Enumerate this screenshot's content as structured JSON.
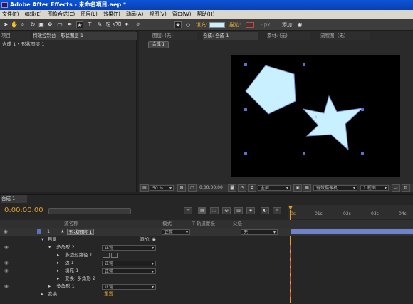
{
  "window": {
    "title": "Adobe After Effects - 未命名项目.aep *"
  },
  "menu": [
    "文件(F)",
    "编辑(E)",
    "图像合成(C)",
    "图层(L)",
    "效果(T)",
    "动画(A)",
    "视图(V)",
    "窗口(W)",
    "帮助(H)"
  ],
  "toolbar": {
    "fill_label": "填充:",
    "stroke_label": "描边:",
    "stroke_px": "- px",
    "add_label": "添加:",
    "fill_color": "#c8f0ff",
    "stroke_color": "#cc4444"
  },
  "project_panel": {
    "tab": "项目",
    "effects_tab": "特效控制台 : 形状图层 1",
    "breadcrumb": "合成 1 • 形状图层 1"
  },
  "comp_panel": {
    "tab_layer": "图层: (无)",
    "tab_comp": "合成: 合成 1",
    "tab_footage": "素材: (无)",
    "tab_flow": "流程图: (无)",
    "comp_button": "合成 1",
    "shape_color": "#c8f0ff"
  },
  "viewer_bar": {
    "zoom": "50 %",
    "time": "0:00:00:00",
    "resolution": "全屏",
    "camera": "有效摄像机",
    "views": "1 视图"
  },
  "timeline": {
    "tab": "合成 1",
    "time": "0:00:00:00",
    "ruler": [
      "0s",
      "01s",
      "02s",
      "03s",
      "04s"
    ],
    "headers": {
      "source": "源名称",
      "mode": "模式",
      "trkmat": "T 轨道蒙板",
      "parent": "父级"
    },
    "layer": {
      "num": "1",
      "name": "形状图层 1",
      "mode": "正常",
      "parent": "无"
    },
    "rows": [
      {
        "label": "目录",
        "extra": "添加:"
      },
      {
        "label": "多角形 2",
        "value": "正常"
      },
      {
        "label": "多边形路径 1"
      },
      {
        "label": "边 1",
        "value": "正常"
      },
      {
        "label": "填充 1",
        "value": "正常"
      },
      {
        "label": "变换: 多角形 2"
      },
      {
        "label": "多角形 1",
        "value": "正常"
      },
      {
        "label": "变换",
        "value": "重置"
      }
    ]
  }
}
